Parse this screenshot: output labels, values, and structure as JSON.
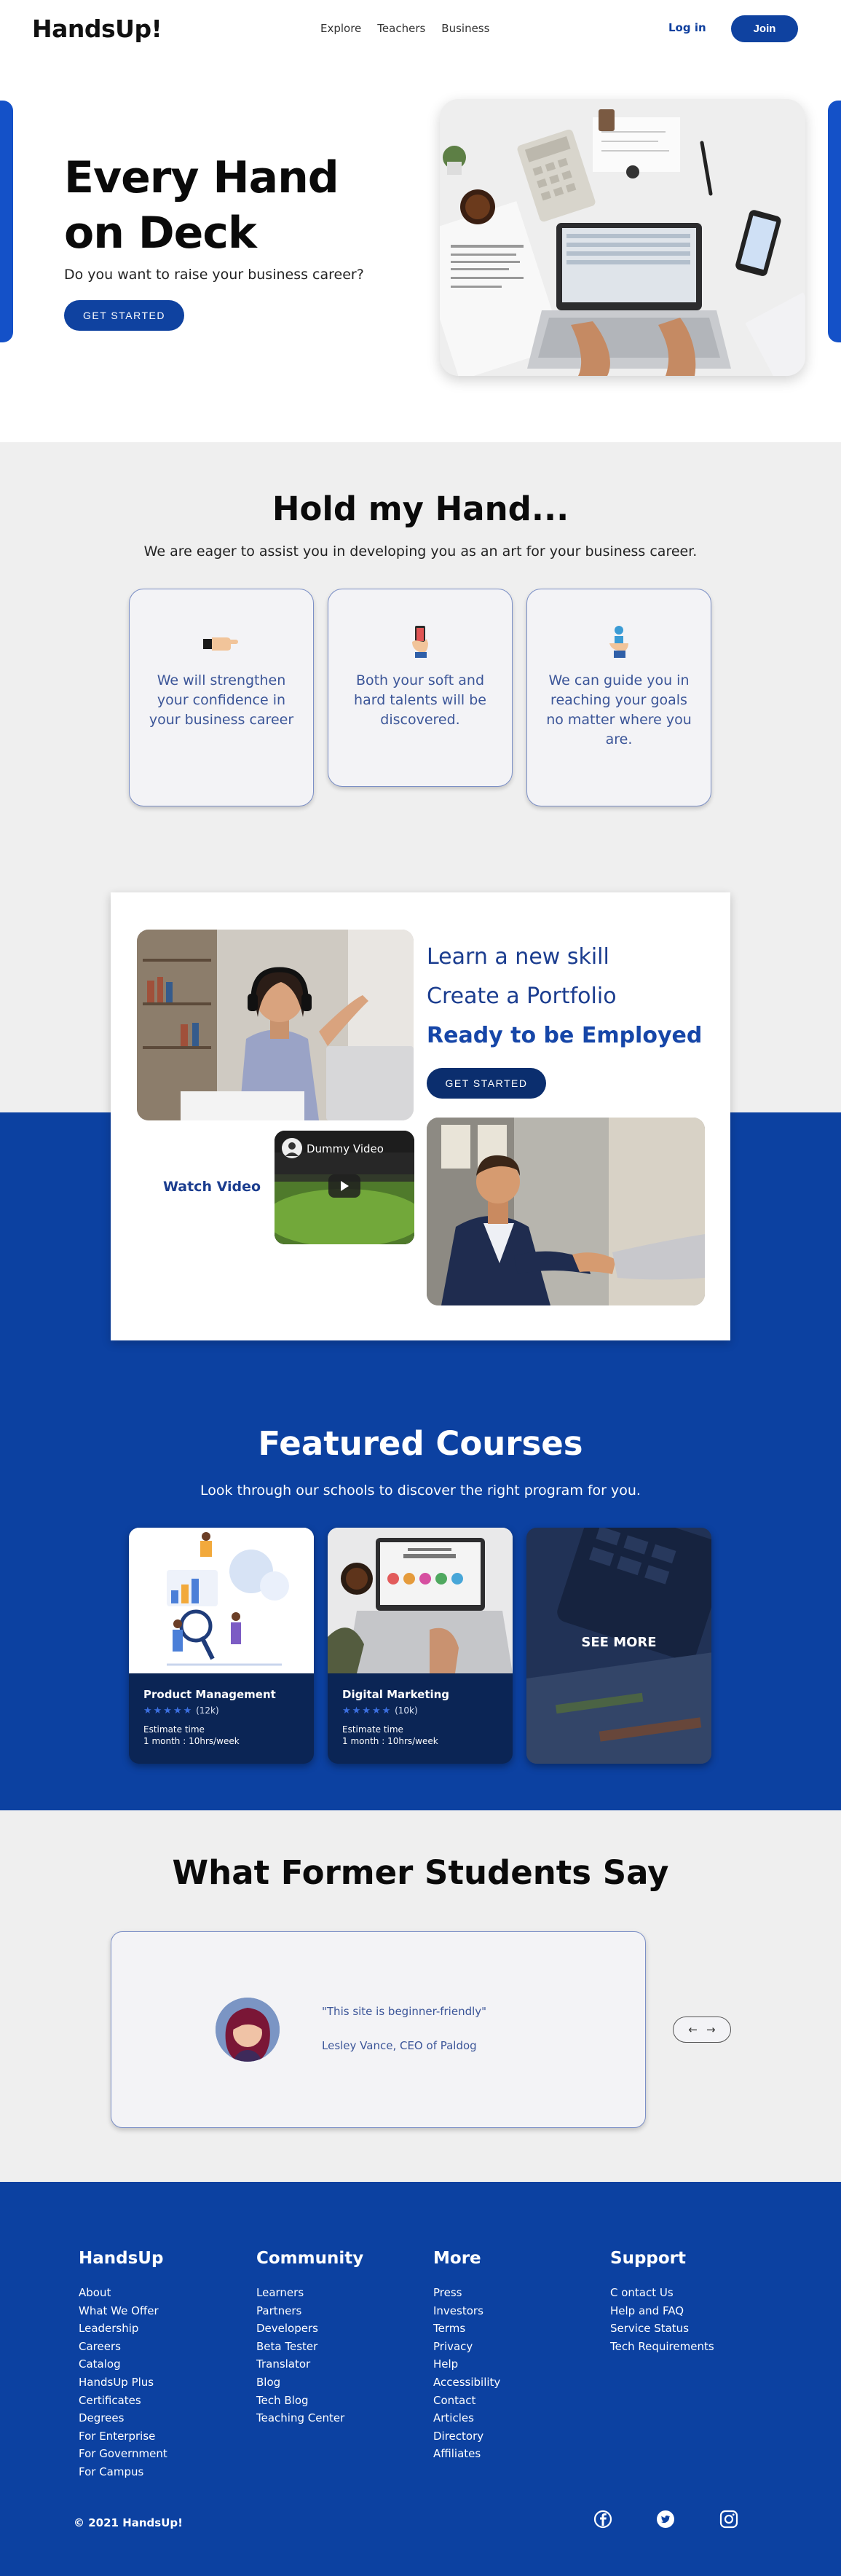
{
  "nav": {
    "logo": "HandsUp!",
    "links": [
      "Explore",
      "Teachers",
      "Business"
    ],
    "login": "Log in",
    "join": "Join"
  },
  "hero": {
    "title_line1": "Every Hand",
    "title_line2": "on Deck",
    "subtitle": "Do you want to raise your business career?",
    "cta": "GET STARTED"
  },
  "hold": {
    "title": "Hold my Hand...",
    "subtitle": "We are eager to assist you in developing you as an art for your business career.",
    "cards": [
      {
        "icon": "pointing-hand-icon",
        "text": "We will strengthen your confidence in your business career"
      },
      {
        "icon": "hand-holding-phone-icon",
        "text": "Both your soft and hard talents will be discovered."
      },
      {
        "icon": "hand-holding-person-icon",
        "text": "We can guide you in reaching your goals no matter where you are."
      }
    ]
  },
  "learn": {
    "line1": "Learn a new skill",
    "line2": "Create a Portfolio",
    "line3": "Ready to be Employed",
    "cta": "GET STARTED",
    "watch": "Watch Video",
    "video_title": "Dummy Video"
  },
  "featured": {
    "title": "Featured Courses",
    "subtitle": "Look through our schools to discover the right program for you.",
    "courses": [
      {
        "name": "Product Management",
        "stars": "★★★★★",
        "reviews": "(12k)",
        "est_label": "Estimate time",
        "est_value": "1 month : 10hrs/week"
      },
      {
        "name": "Digital Marketing",
        "stars": "★★★★★",
        "reviews": "(10k)",
        "est_label": "Estimate time",
        "est_value": "1 month : 10hrs/week"
      }
    ],
    "see_more": "SEE MORE"
  },
  "testimonial": {
    "title": "What Former Students Say",
    "quote": "\"This site is beginner-friendly\"",
    "author": "Lesley Vance, CEO of Paldog",
    "prev": "←",
    "next": "→"
  },
  "footer": {
    "columns": [
      {
        "title": "HandsUp",
        "links": [
          "About",
          "What We Offer",
          "Leadership",
          "Careers",
          "Catalog",
          "HandsUp Plus",
          "Certificates",
          "Degrees",
          "For Enterprise",
          "For Government",
          "For Campus"
        ]
      },
      {
        "title": "Community",
        "links": [
          "Learners",
          "Partners",
          "Developers",
          "Beta Tester",
          "Translator",
          "Blog",
          "Tech Blog",
          "Teaching Center"
        ]
      },
      {
        "title": "More",
        "links": [
          "Press",
          "Investors",
          "Terms",
          "Privacy",
          "Help",
          "Accessibility",
          "Contact",
          "Articles",
          "Directory",
          "Affiliates"
        ]
      },
      {
        "title": "Support",
        "links": [
          "C ontact Us",
          "Help and FAQ",
          "Service Status",
          "Tech Requirements"
        ]
      }
    ],
    "copyright": "© 2021 HandsUp!",
    "social": [
      "facebook-icon",
      "twitter-icon",
      "instagram-icon"
    ]
  },
  "colors": {
    "brand_blue": "#0c41a1",
    "dark_navy": "#0b2e6e",
    "card_text": "#3b5598",
    "section_gray": "#efefef"
  }
}
